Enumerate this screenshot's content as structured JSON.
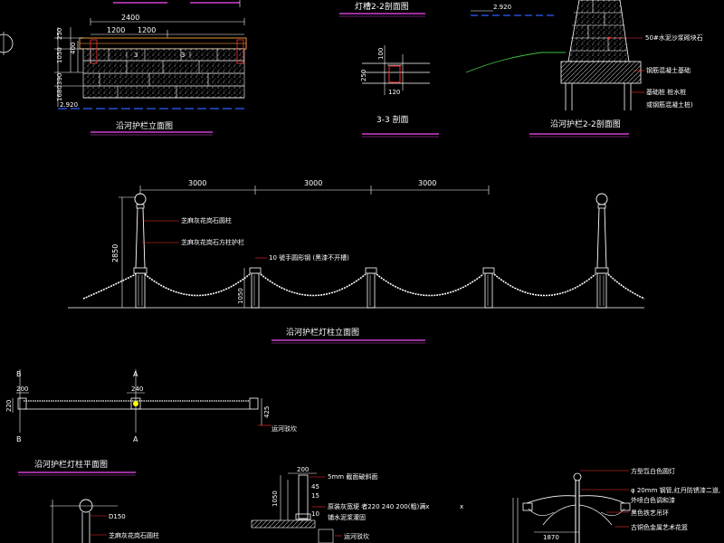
{
  "elevation_top": {
    "title": "沿河护栏立面图",
    "dims": {
      "total": "2400",
      "half_a": "1200",
      "half_b": "1200",
      "h250": "250",
      "h1050": "1050",
      "h400": "400",
      "h390": "390",
      "h1680": "1680"
    },
    "markers": {
      "m1": "3",
      "m2": "3"
    },
    "water_level": "2.920"
  },
  "lamp_slot_section": {
    "title": "灯槽2-2剖面图",
    "dims": {
      "d100": "100",
      "d250": "250",
      "d120": "120"
    }
  },
  "section_33": {
    "title": "3-3 剖面"
  },
  "section_22": {
    "title": "沿河护栏2-2剖面图",
    "water_level": "2.920",
    "labels": {
      "stone": "50#水泥沙浆砌块石",
      "concrete": "钢筋混凝土基础",
      "pile1": "基础桩 桩水桩",
      "pile2": "或钢筋混凝土桩)"
    }
  },
  "lamp_elevation": {
    "title": "沿河护栏灯柱立面图",
    "spans": [
      "3000",
      "3000",
      "3000"
    ],
    "height_total": "2850",
    "height_post": "1050",
    "labels": {
      "granite_round": "芝麻灰花岗石圆柱",
      "granite_square": "芝麻灰花岗石方柱护栏",
      "chain": "10 號手圆形钢 (黑漆不开槽)"
    }
  },
  "lamp_plan": {
    "title": "沿河护栏灯柱平面图",
    "markers": {
      "b": "B",
      "a": "A"
    },
    "dims": {
      "d200": "200",
      "d240": "240",
      "d220": "220",
      "d425": "425"
    },
    "label": "运河驳坎"
  },
  "lamp_detail": {
    "diameter": "D150",
    "label": "芝麻灰花岗石圆柱"
  },
  "post_detail": {
    "dims": {
      "d200": "200",
      "d1050": "1050",
      "d45": "45",
      "d15": "15",
      "d10": "10"
    },
    "labels": {
      "finish": "5mm 截面破斜面",
      "spec1": "原装灰宽埂 者220 240 200(粗)满x",
      "spec2": "铺水泥浆灌固",
      "bank": "运河驳坎"
    }
  },
  "light_detail": {
    "dim": "1870",
    "labels": {
      "lamp": "方型氙白色圆灯",
      "tube1": "φ 20mm 钢管,红丹防锈漆二道,",
      "tube2": "外喷白色调和漆",
      "iron": "黑色铁艺吊环",
      "cast": "古铜色金属艺术花篮"
    }
  }
}
